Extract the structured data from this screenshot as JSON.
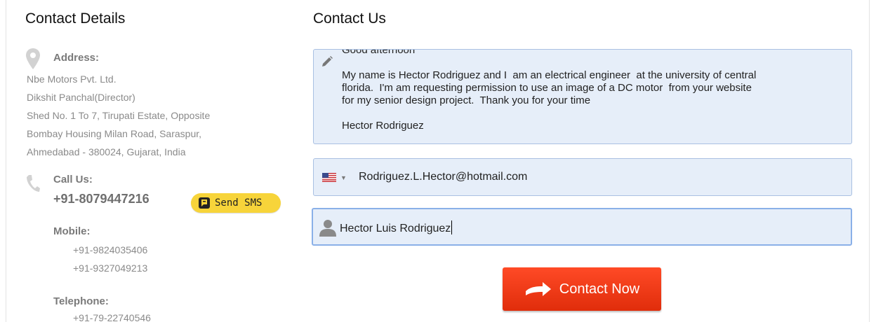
{
  "contact_details": {
    "title": "Contact Details",
    "address": {
      "label": "Address:",
      "lines": [
        "Nbe Motors Pvt. Ltd.",
        "Dikshit Panchal(Director)",
        "Shed No. 1 To 7, Tirupati Estate, Opposite",
        "Bombay Housing Milan Road, Saraspur,",
        "Ahmedabad - 380024, Gujarat, India"
      ],
      "icon": "map-pin-icon"
    },
    "call": {
      "label": "Call Us:",
      "number": "+91-8079447216",
      "icon": "phone-icon"
    },
    "sms_button": {
      "label": "Send SMS",
      "icon": "sms-icon",
      "color": "#f7d43a"
    },
    "mobile": {
      "label": "Mobile:",
      "numbers": [
        "+91-9824035406",
        "+91-9327049213"
      ]
    },
    "telephone": {
      "label": "Telephone:",
      "number": "+91-79-22740546"
    }
  },
  "contact_us": {
    "title": "Contact Us",
    "message": {
      "icon": "pencil-icon",
      "value": "Good afternoon\n\nMy name is Hector Rodriguez and I  am an electrical engineer  at the university of central\nflorida.  I'm am requesting permission to use an image of a DC motor  from your website\nfor my senior design project.  Thank you for your time\n\nHector Rodriguez"
    },
    "email": {
      "flag_icon": "us-flag-icon",
      "value": "Rodriguez.L.Hector@hotmail.com"
    },
    "name": {
      "icon": "user-icon",
      "value": "Hector Luis Rodriguez"
    },
    "submit_button": {
      "label": "Contact Now",
      "icon": "arrow-right-icon",
      "color": "#e8360f"
    }
  }
}
